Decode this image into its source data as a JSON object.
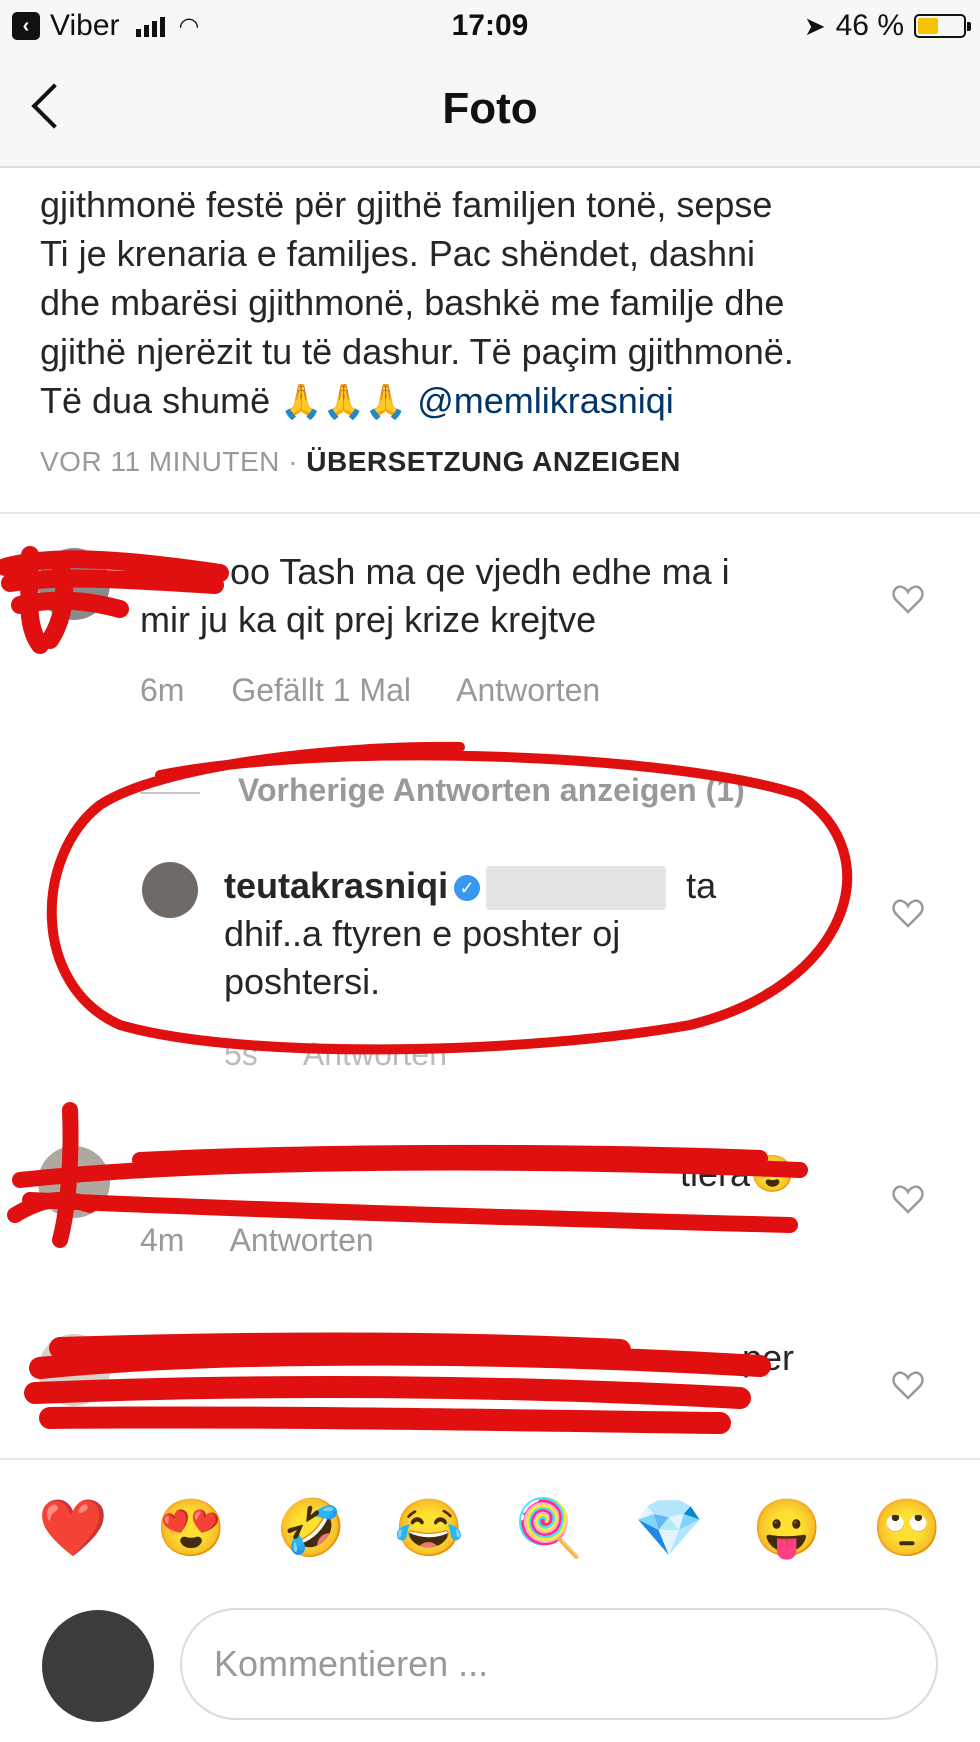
{
  "status_bar": {
    "back_app": "Viber",
    "time": "17:09",
    "battery_percent": "46 %",
    "battery_level": 0.46,
    "icons": [
      "signal-icon",
      "wifi-icon",
      "location-arrow-icon",
      "battery-icon"
    ]
  },
  "nav": {
    "title": "Foto",
    "back_icon": "chevron-left-icon"
  },
  "caption": {
    "lines": [
      "gjithmonë festë për gjithë familjen tonë, sepse",
      "Ti je krenaria e familjes. Pac shëndet, dashni",
      "dhe mbarësi gjithmonë, bashkë me familje dhe",
      "gjithë njerëzit tu të dashur. Të paçim gjithmonë."
    ],
    "last_line_text": "Të dua shumë",
    "emoji": "🙏🙏🙏",
    "mention": "@memlikrasniqi"
  },
  "meta": {
    "time": "VOR 11 MINUTEN",
    "separator": "·",
    "translate": "ÜBERSETZUNG ANZEIGEN"
  },
  "comments": [
    {
      "username": "",
      "text_line1": "oo Tash ma qe vjedh edhe ma i",
      "text_line2": "mir ju ka qit prej krize krejtve",
      "time": "6m",
      "likes": "Gefällt 1 Mal",
      "reply": "Antworten"
    }
  ],
  "replies_toggle": "Vorherige Antworten anzeigen (1)",
  "reply": {
    "username": "teutakrasniqi",
    "text_after_name": "ta",
    "text_line2": "dhif..a ftyren e poshter oj",
    "text_line3": "poshtersi.",
    "time": "5s",
    "reply": "Antworten"
  },
  "comment3": {
    "text": "tiera",
    "emoji": "😍",
    "time": "4m",
    "reply": "Antworten"
  },
  "comment4": {
    "text": "per"
  },
  "emoji_bar": [
    "❤️",
    "😍",
    "🤣",
    "😂",
    "🍭",
    "💎",
    "😛",
    "🙄"
  ],
  "input": {
    "placeholder": "Kommentieren ..."
  },
  "colors": {
    "accent_blue": "#3897f0",
    "mention": "#003569",
    "scribble_red": "#e01010"
  }
}
